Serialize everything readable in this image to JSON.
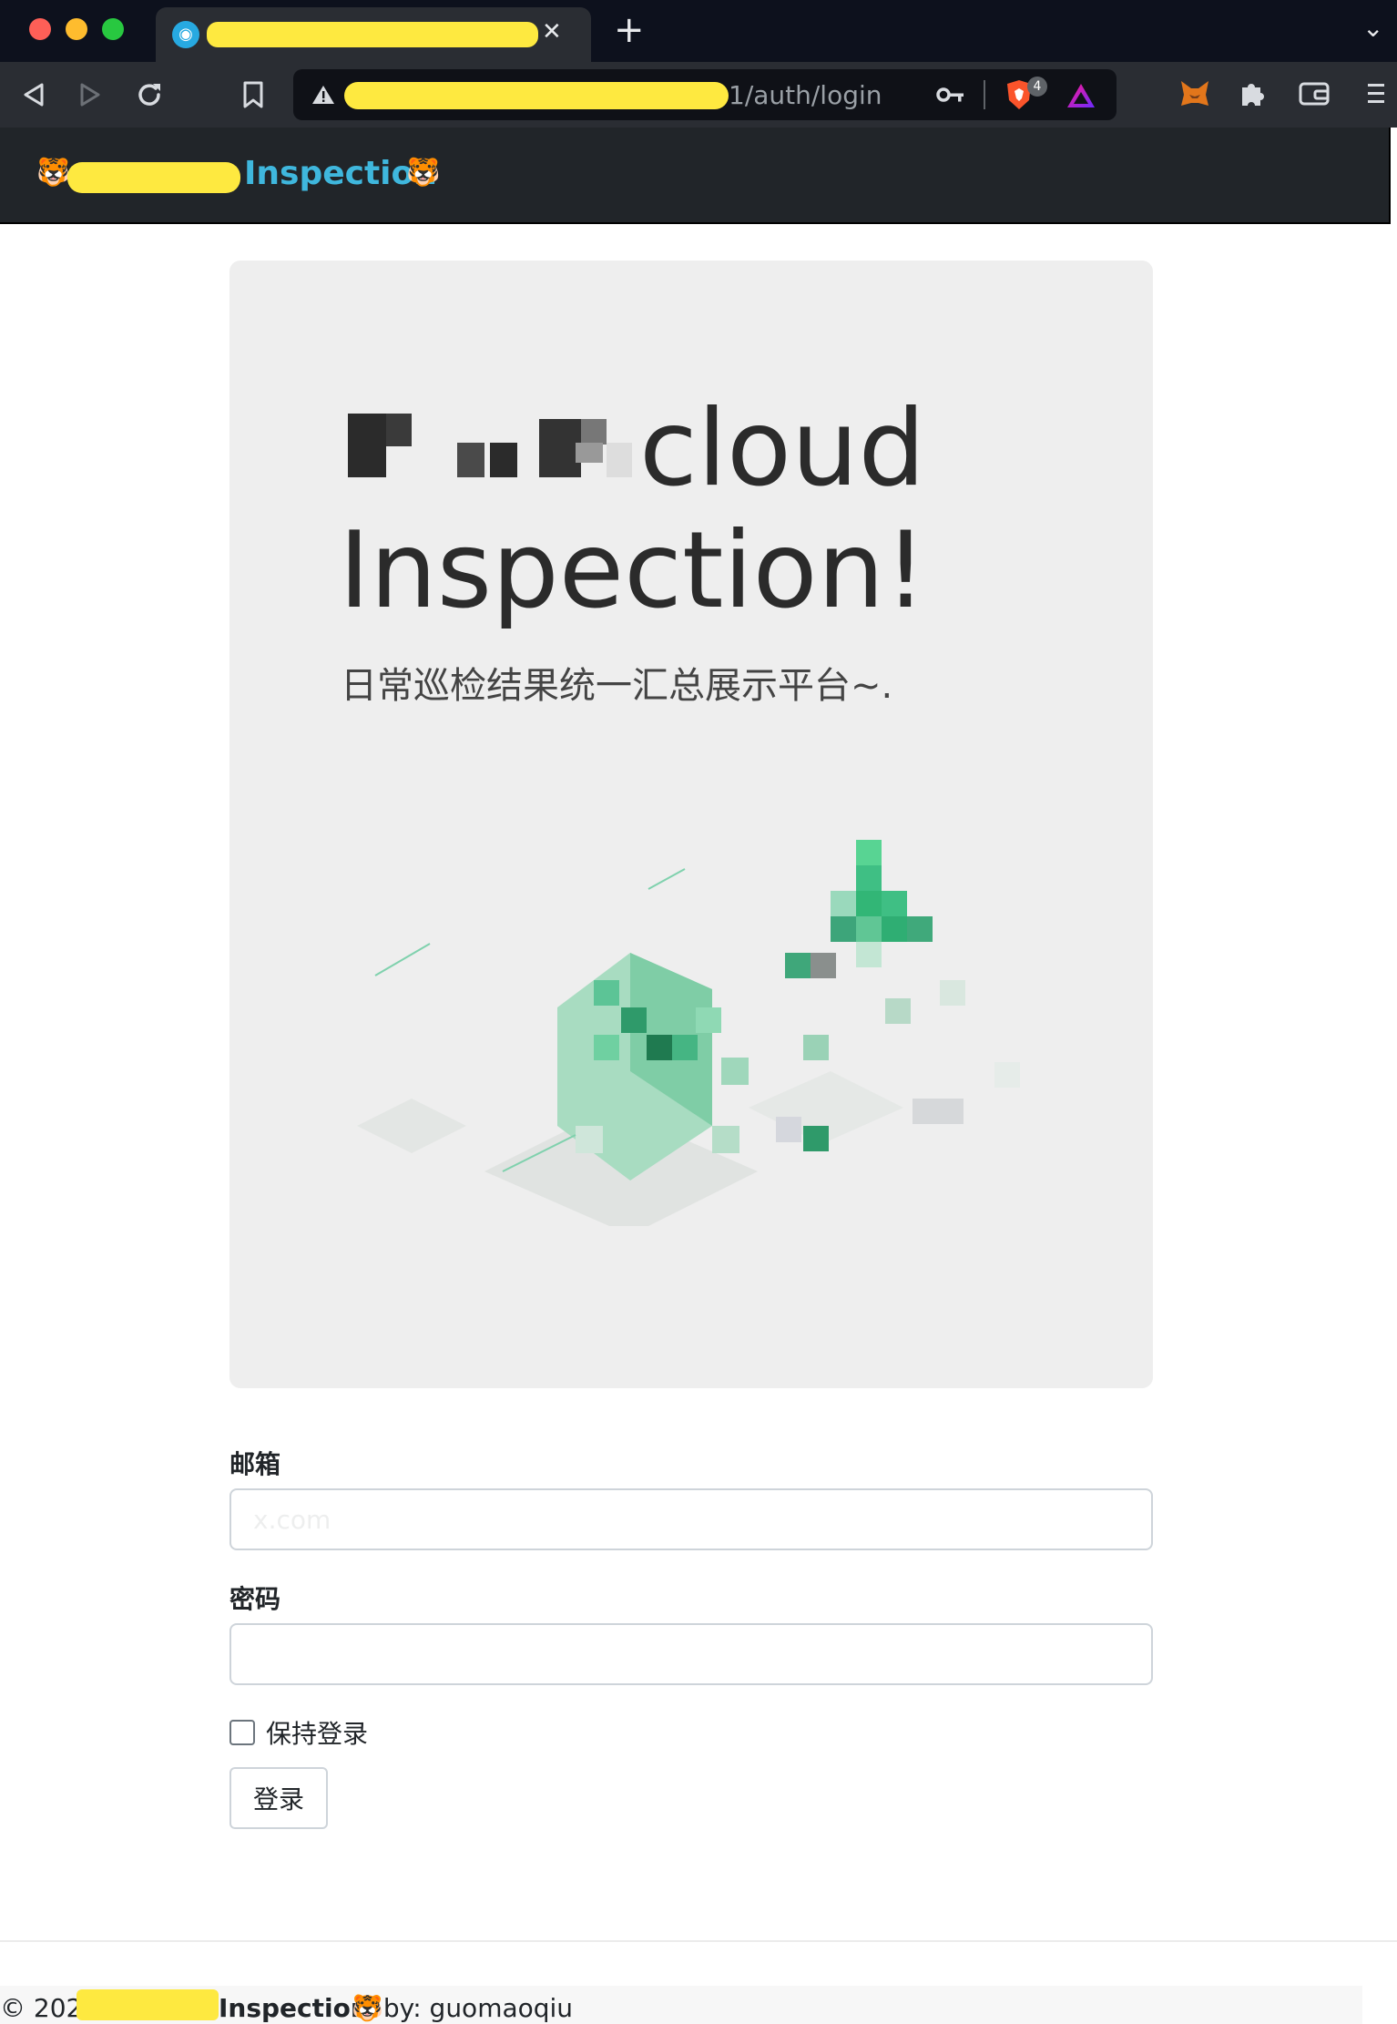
{
  "browser": {
    "tab_close": "✕",
    "new_tab": "+",
    "tab_menu": "⌄",
    "url_path": "1/auth/login",
    "shield_count": "4"
  },
  "navbar": {
    "brand_text": "Inspection",
    "left_emoji": "🐯",
    "right_emoji": "🐯"
  },
  "hero": {
    "title_line1": "cloud",
    "title_line2": "Inspection!",
    "lead": "日常巡检结果统一汇总展示平台~."
  },
  "form": {
    "email_label": "邮箱",
    "email_value": "x.com",
    "password_label": "密码",
    "password_value": "",
    "remember_label": "保持登录",
    "submit_label": "登录"
  },
  "footer": {
    "copyright": "© 2022",
    "brand": "Inspection",
    "emoji": "🐯",
    "by": " by: guomaoqiu"
  },
  "colors": {
    "brand_link": "#3fb7dd",
    "navbar_bg": "#212529",
    "hero_bg": "#eeeeee",
    "redaction": "#fee940",
    "illustration_green": "#3fbf84"
  },
  "icons": [
    "back-icon",
    "forward-icon",
    "reload-icon",
    "bookmark-icon",
    "warning-icon",
    "key-icon",
    "brave-shield-icon",
    "brave-rewards-icon",
    "metamask-icon",
    "extensions-icon",
    "wallet-icon",
    "menu-icon"
  ]
}
